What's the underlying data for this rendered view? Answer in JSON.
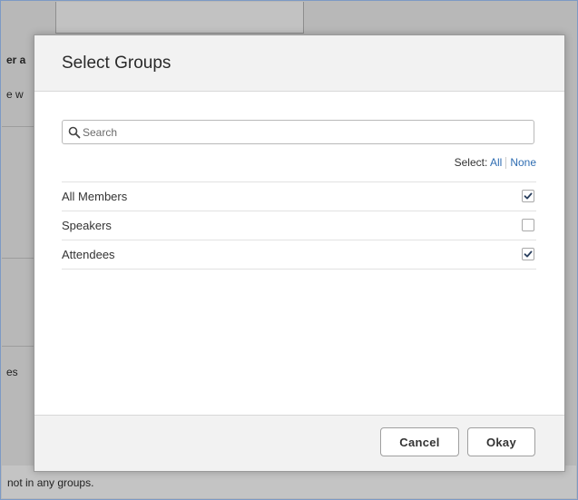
{
  "background": {
    "text_1": "er a",
    "text_2": "e w",
    "text_3": "es",
    "footer_text": "not in any groups."
  },
  "dialog": {
    "title": "Select Groups",
    "search": {
      "placeholder": "Search",
      "value": ""
    },
    "select_label": "Select:",
    "select_all": "All",
    "select_none": "None",
    "groups": [
      {
        "label": "All Members",
        "checked": true
      },
      {
        "label": "Speakers",
        "checked": false
      },
      {
        "label": "Attendees",
        "checked": true
      }
    ],
    "cancel_label": "Cancel",
    "okay_label": "Okay"
  },
  "colors": {
    "link": "#2f6db2",
    "overlay": "#b8b8b8",
    "checkmark": "#2a3f5e"
  },
  "icons": {
    "search": "search-icon",
    "checkbox_checked": "check-icon"
  }
}
